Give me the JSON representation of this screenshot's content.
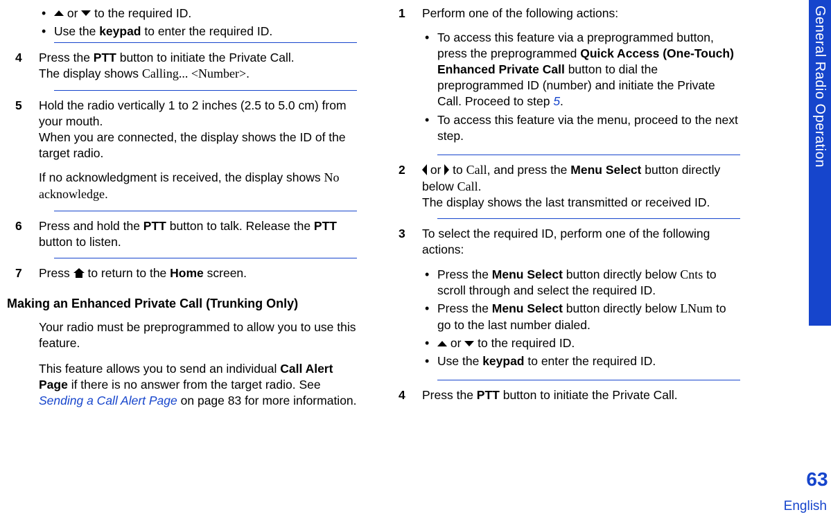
{
  "sidetab": {
    "label": "General Radio Operation"
  },
  "pagenum": "63",
  "language": "English",
  "left": {
    "bullet3a_pre": " or ",
    "bullet3a_post": " to the required ID.",
    "bullet3b_pre": "Use the ",
    "bullet3b_bold": "keypad",
    "bullet3b_post": " to enter the required ID.",
    "step4": {
      "num": "4",
      "l1a": "Press the ",
      "l1b": "PTT",
      "l1c": " button to initiate the Private Call.",
      "l2a": "The display shows ",
      "l2b": "Calling... <Number>",
      "l2c": "."
    },
    "step5": {
      "num": "5",
      "l1": "Hold the radio vertically 1 to 2 inches (2.5 to 5.0 cm) from your mouth.",
      "l2": "When you are connected, the display shows the ID of the target radio.",
      "l3a": "If no acknowledgment is received, the display shows ",
      "l3b": "No acknowledge",
      "l3c": "."
    },
    "step6": {
      "num": "6",
      "l1a": "Press and hold the ",
      "l1b": "PTT",
      "l1c": " button to talk. Release the ",
      "l1d": "PTT",
      "l1e": " button to listen."
    },
    "step7": {
      "num": "7",
      "l1a": "Press ",
      "l1b": " to return to the ",
      "l1c": "Home",
      "l1d": " screen."
    },
    "heading": "Making an Enhanced Private Call (Trunking Only)",
    "p1": "Your radio must be preprogrammed to allow you to use this feature.",
    "p2a": "This feature allows you to send an individual ",
    "p2b": "Call Alert Page",
    "p2c": " if there is no answer from the target radio. See ",
    "p2link": "Sending a Call Alert Page",
    "p2d": " on page 83 for more information."
  },
  "right": {
    "step1": {
      "num": "1",
      "l1": "Perform one of the following actions:",
      "b1a": "To access this feature via a preprogrammed button, press the preprogrammed ",
      "b1b": "Quick Access (One-Touch) Enhanced Private Call",
      "b1c": " button to dial the preprogrammed ID (number) and initiate the Private Call. Proceed to step ",
      "b1link": "5",
      "b1d": ".",
      "b2": "To access this feature via the menu, proceed to the next step."
    },
    "step2": {
      "num": "2",
      "l1a": " or ",
      "l1b": " to ",
      "l1c": "Call",
      "l1d": ", and press the ",
      "l1e": "Menu Select",
      "l1f": " button directly below ",
      "l1g": "Call",
      "l1h": ".",
      "l2": "The display shows the last transmitted or received ID."
    },
    "step3": {
      "num": "3",
      "l1": "To select the required ID, perform one of the following actions:",
      "b1a": "Press the ",
      "b1b": "Menu Select",
      "b1c": " button directly below ",
      "b1d": "Cnts",
      "b1e": " to scroll through and select the required ID.",
      "b2a": "Press the ",
      "b2b": "Menu Select",
      "b2c": " button directly below ",
      "b2d": "LNum",
      "b2e": " to go to the last number dialed.",
      "b3a": " or ",
      "b3b": " to the required ID.",
      "b4a": "Use the ",
      "b4b": "keypad",
      "b4c": " to enter the required ID."
    },
    "step4": {
      "num": "4",
      "l1a": "Press the ",
      "l1b": "PTT",
      "l1c": " button to initiate the Private Call."
    }
  }
}
